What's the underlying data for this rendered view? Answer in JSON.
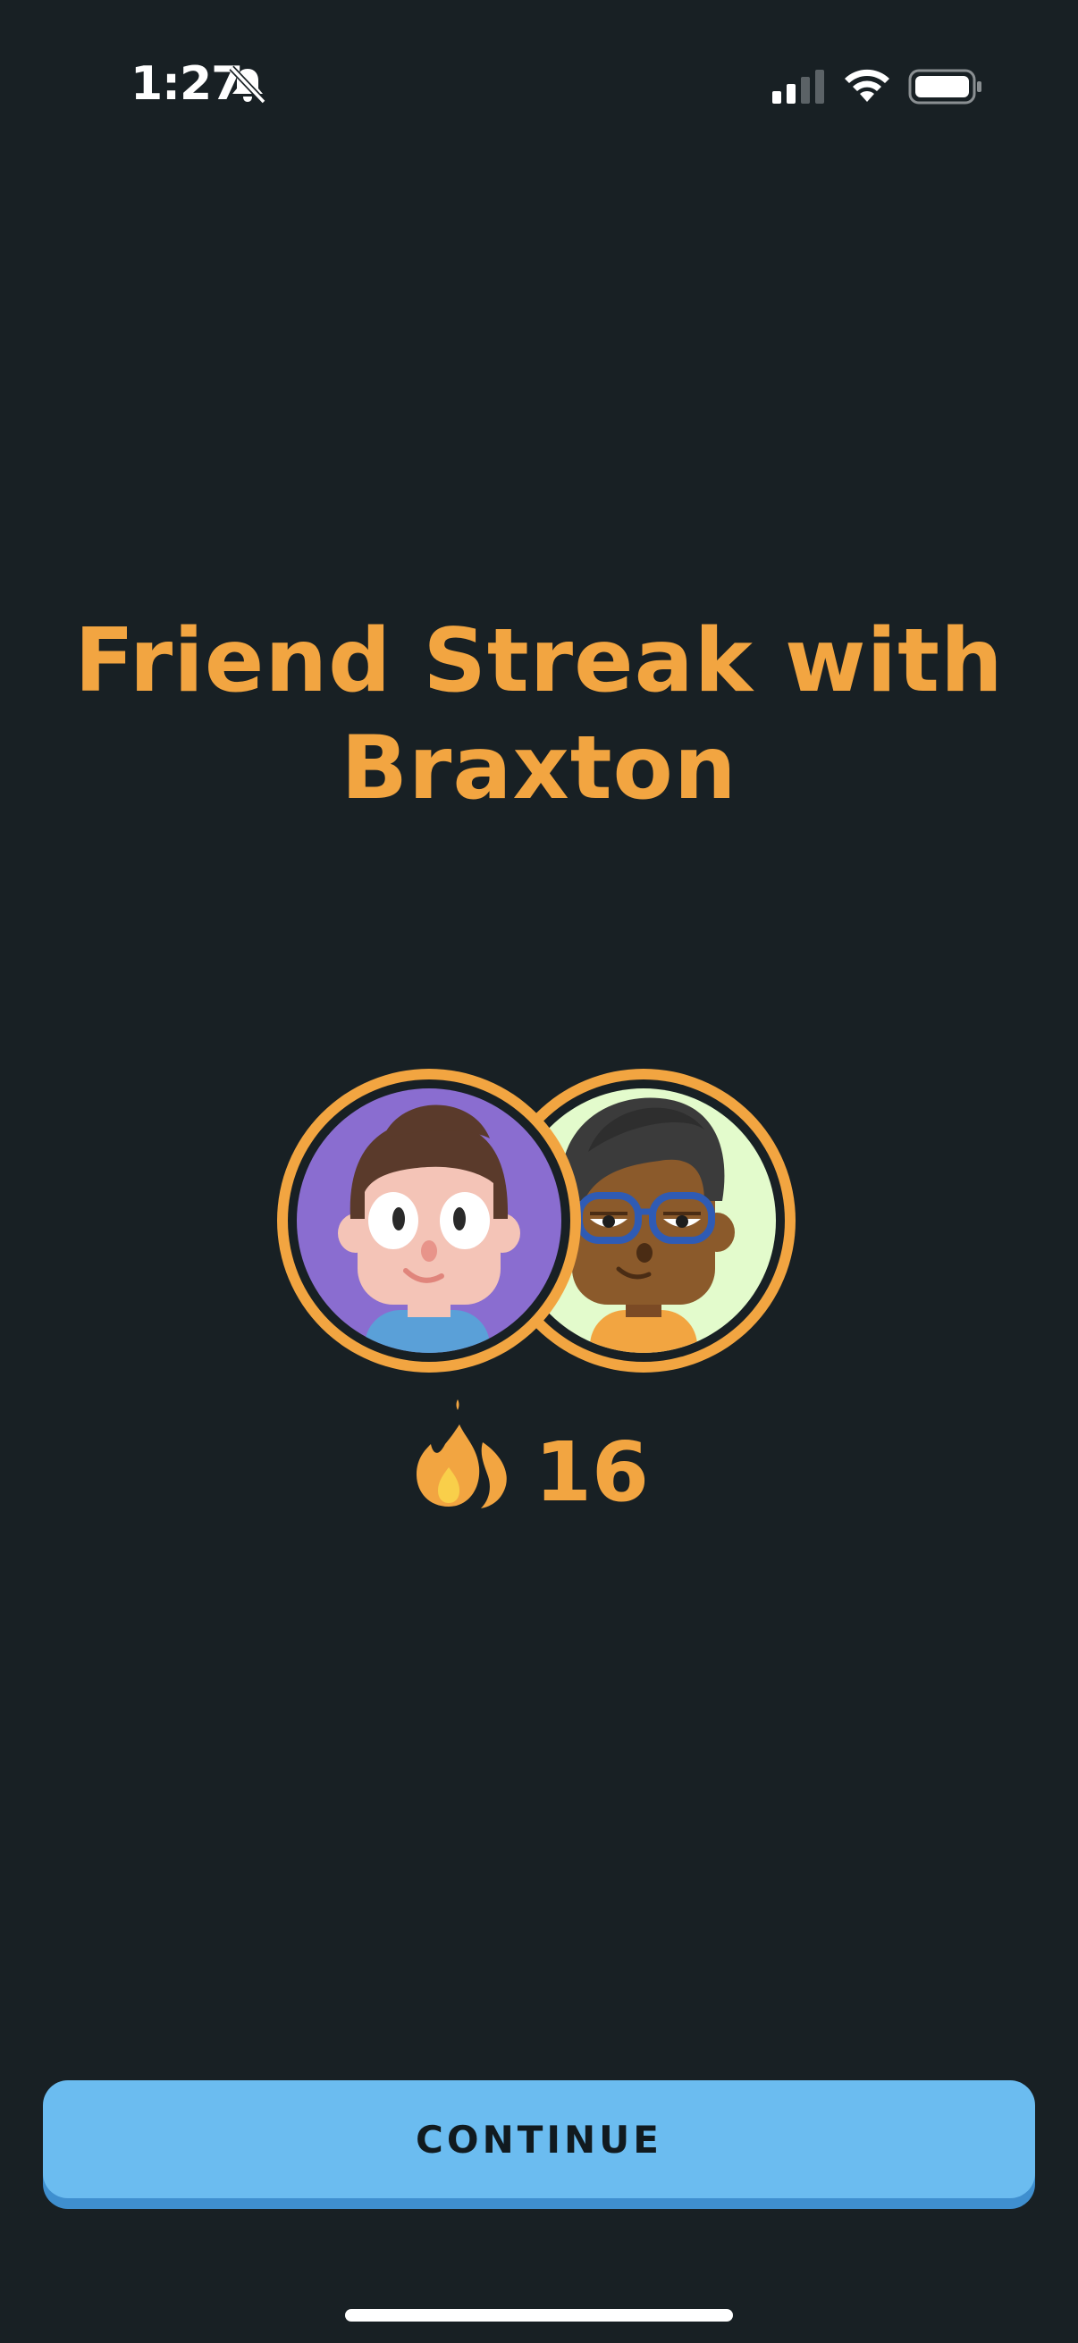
{
  "status_bar": {
    "time": "1:27",
    "icons": [
      "bell-slash-icon",
      "cellular-signal-icon",
      "wifi-icon",
      "battery-icon"
    ]
  },
  "title": {
    "line1": "Friend Streak with",
    "line2": "Braxton"
  },
  "avatars": [
    {
      "name": "user-avatar",
      "background": "#8a6dd0"
    },
    {
      "name": "braxton-avatar",
      "background": "#e3fbcc"
    }
  ],
  "streak": {
    "icon": "flame-icon",
    "count": "16"
  },
  "continue_button": {
    "label": "CONTINUE"
  },
  "colors": {
    "background": "#182024",
    "accent_orange": "#f2a541",
    "button_blue": "#6bbcf0",
    "button_shadow": "#3f8fcf"
  }
}
